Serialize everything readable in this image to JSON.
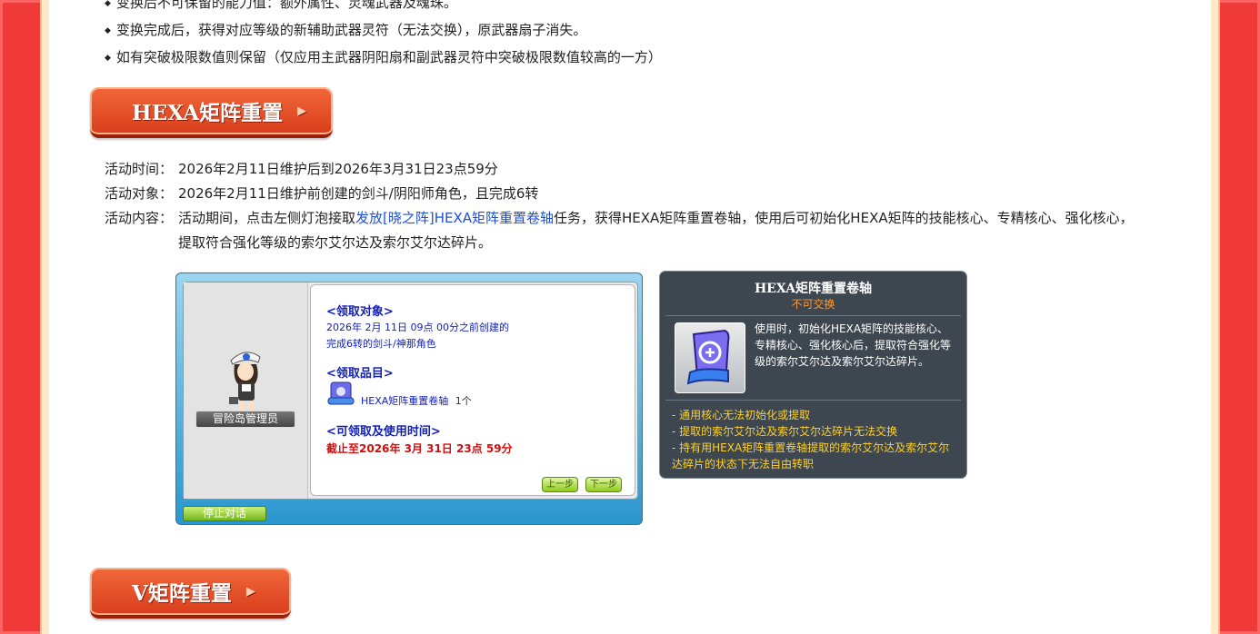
{
  "bullets": [
    "变换后不可保留的能力值：额外属性、灵魂武器及魂珠。",
    "变换完成后，获得对应等级的新辅助武器灵符（无法交换），原武器扇子消失。",
    "如有突破极限数值则保留（仅应用主武器阴阳扇和副武器灵符中突破极限数值较高的一方）"
  ],
  "sections": {
    "hexa_title": "HEXA矩阵重置",
    "v_title": "V矩阵重置",
    "arrow": "▶"
  },
  "event": {
    "time_label": "活动时间：",
    "time_value": "2026年2月11日维护后到2026年3月31日23点59分",
    "target_label": "活动对象：",
    "target_value": "2026年2月11日维护前创建的剑斗/阴阳师角色，且完成6转",
    "content_label": "活动内容：",
    "content_prefix": "活动期间，点击左侧灯泡接取",
    "content_link": "发放[晓之阵]HEXA矩阵重置卷轴",
    "content_suffix": "任务，获得HEXA矩阵重置卷轴，使用后可初始化HEXA矩阵的技能核心、专精核心、强化核心，",
    "content_line2": "提取符合强化等级的索尔艾尔达及索尔艾尔达碎片。"
  },
  "npc_dialog": {
    "npc_name": "冒险岛管理员",
    "h_target": "<领取对象>",
    "target_line1": "2026年 2月 11日 09点 00分之前创建的",
    "target_line2": "完成6转的剑斗/神那角色",
    "h_item": "<领取品目>",
    "item_name": "HEXA矩阵重置卷轴",
    "item_count": "1个",
    "h_time": "<可领取及使用时间>",
    "time_value": "截止至2026年 3月 31日 23点 59分",
    "prev_btn": "上一步",
    "next_btn": "下一步",
    "stop_btn": "停止对话"
  },
  "tooltip": {
    "title": "HEXA矩阵重置卷轴",
    "subtitle": "不可交换",
    "description": "使用时，初始化HEXA矩阵的技能核心、专精核心、强化核心后，提取符合强化等级的索尔艾尔达及索尔艾尔达碎片。",
    "notes": [
      "- 通用核心无法初始化或提取",
      "- 提取的索尔艾尔达及索尔艾尔达碎片无法交换",
      "- 持有用HEXA矩阵重置卷轴提取的索尔艾尔达及索尔艾尔达碎片的状态下无法自由转职"
    ]
  }
}
